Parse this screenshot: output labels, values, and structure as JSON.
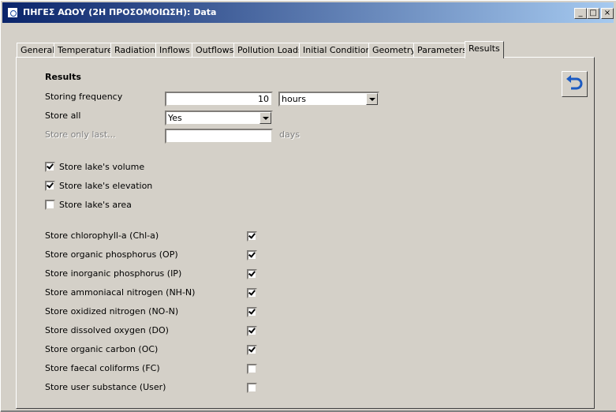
{
  "window": {
    "title": "ΠΗΓΕΣ ΑΩΟΥ (2Η ΠΡΟΣΟΜΟΙΩΣΗ): Data",
    "controls": {
      "minimize": "_",
      "maximize": "□",
      "close": "×"
    }
  },
  "tabs": [
    "General",
    "Temperature",
    "Radiation",
    "Inflows",
    "Outflows",
    "Pollution Loads",
    "Initial Conditions",
    "Geometry",
    "Parameters",
    "Results"
  ],
  "active_tab": "Results",
  "results": {
    "heading": "Results",
    "storing_frequency": {
      "label": "Storing frequency",
      "value": "10",
      "unit": "hours"
    },
    "store_all": {
      "label": "Store all",
      "value": "Yes"
    },
    "store_only_last": {
      "label": "Store only last...",
      "value": "",
      "unit": "days"
    },
    "lake_checks": [
      {
        "label": "Store lake's volume",
        "checked": true
      },
      {
        "label": "Store lake's elevation",
        "checked": true
      },
      {
        "label": "Store lake's area",
        "checked": false
      }
    ],
    "substance_checks": [
      {
        "label": "Store chlorophyll-a (Chl-a)",
        "checked": true
      },
      {
        "label": "Store organic phosphorus (OP)",
        "checked": true
      },
      {
        "label": "Store inorganic phosphorus (IP)",
        "checked": true
      },
      {
        "label": "Store ammoniacal nitrogen (NH-N)",
        "checked": true
      },
      {
        "label": "Store oxidized nitrogen (NO-N)",
        "checked": true
      },
      {
        "label": "Store dissolved oxygen (DO)",
        "checked": true
      },
      {
        "label": "Store organic carbon (OC)",
        "checked": true
      },
      {
        "label": "Store faecal coliforms (FC)",
        "checked": false
      },
      {
        "label": "Store user substance (User)",
        "checked": false
      }
    ]
  },
  "icons": {
    "app": "app-icon",
    "undo": "undo-arrow-icon"
  },
  "colors": {
    "titlebar_start": "#0a246a",
    "titlebar_end": "#a6caf0",
    "face": "#d4d0c8",
    "undo_arrow": "#1c5bc2"
  }
}
